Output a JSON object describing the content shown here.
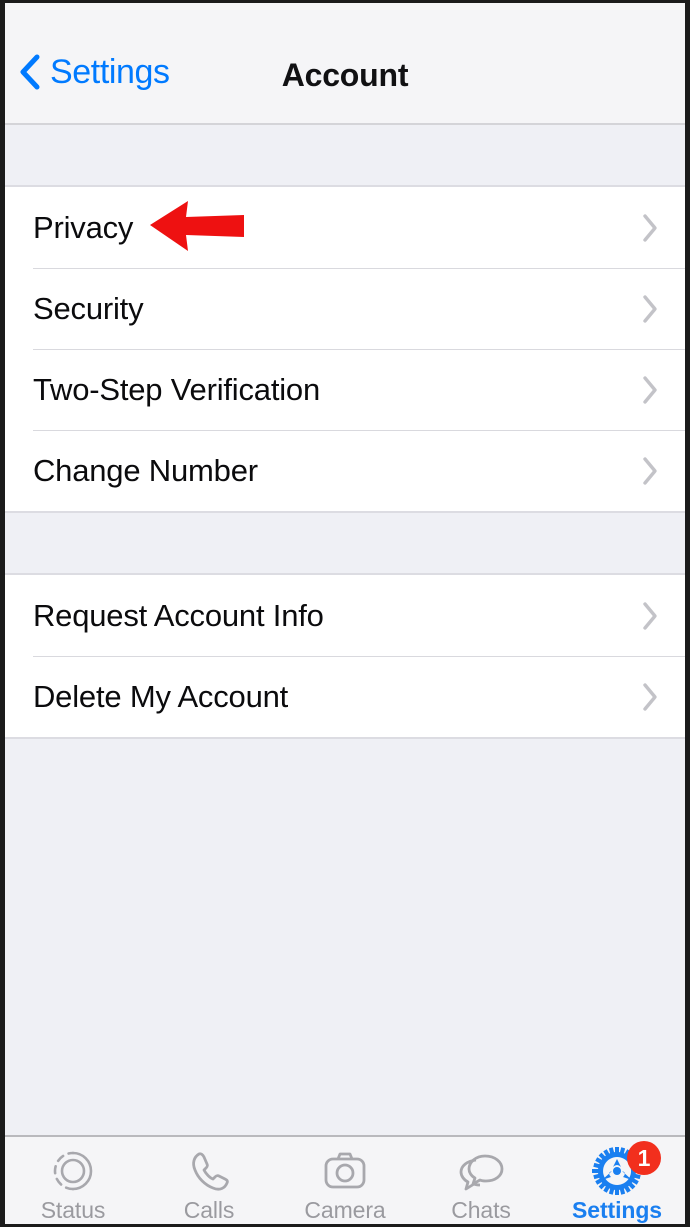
{
  "navbar": {
    "back_label": "Settings",
    "back_icon": "chevron-left-icon",
    "title": "Account",
    "accent_color": "#007aff"
  },
  "groups": [
    {
      "rows": [
        {
          "label": "Privacy",
          "chevron": "chevron-right-icon",
          "annotated": true
        },
        {
          "label": "Security",
          "chevron": "chevron-right-icon"
        },
        {
          "label": "Two-Step Verification",
          "chevron": "chevron-right-icon"
        },
        {
          "label": "Change Number",
          "chevron": "chevron-right-icon"
        }
      ]
    },
    {
      "rows": [
        {
          "label": "Request Account Info",
          "chevron": "chevron-right-icon"
        },
        {
          "label": "Delete My Account",
          "chevron": "chevron-right-icon"
        }
      ]
    }
  ],
  "annotation": {
    "type": "arrow-left",
    "color": "#ee1111",
    "points_to": "Privacy"
  },
  "tabbar": {
    "items": [
      {
        "label": "Status",
        "icon": "status-rings-icon",
        "active": false
      },
      {
        "label": "Calls",
        "icon": "phone-handset-icon",
        "active": false
      },
      {
        "label": "Camera",
        "icon": "camera-icon",
        "active": false
      },
      {
        "label": "Chats",
        "icon": "chat-bubbles-icon",
        "active": false
      },
      {
        "label": "Settings",
        "icon": "gear-icon",
        "active": true,
        "badge": "1"
      }
    ],
    "active_color": "#1a7ff0",
    "inactive_color": "#9a9a9f",
    "badge_color": "#f22f1d"
  }
}
